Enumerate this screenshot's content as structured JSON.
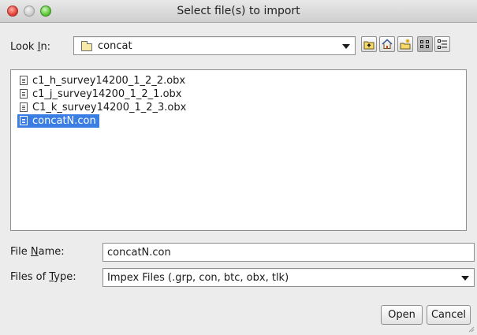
{
  "window": {
    "title": "Select file(s) to import"
  },
  "look_in": {
    "label_pre": "Look ",
    "label_mnemonic": "I",
    "label_post": "n:",
    "value": "concat"
  },
  "toolbar": {
    "buttons": [
      {
        "icon": "up-folder-icon"
      },
      {
        "icon": "home-icon"
      },
      {
        "icon": "new-folder-icon"
      },
      {
        "icon": "list-view-icon"
      },
      {
        "icon": "details-view-icon"
      }
    ]
  },
  "files": [
    {
      "name": "c1_h_survey14200_1_2_2.obx",
      "selected": false
    },
    {
      "name": "c1_j_survey14200_1_2_1.obx",
      "selected": false
    },
    {
      "name": "C1_k_survey14200_1_2_3.obx",
      "selected": false
    },
    {
      "name": "concatN.con",
      "selected": true
    }
  ],
  "file_name": {
    "label_pre": "File ",
    "label_mnemonic": "N",
    "label_post": "ame:",
    "value": "concatN.con"
  },
  "file_type": {
    "label_pre": "Files of ",
    "label_mnemonic": "T",
    "label_post": "ype:",
    "value": "Impex Files (.grp, con, btc, obx, tlk)"
  },
  "actions": {
    "open": "Open",
    "cancel": "Cancel"
  },
  "colors": {
    "selection": "#3a7ee4",
    "close": "#e0443a",
    "zoom": "#5ec93b"
  }
}
